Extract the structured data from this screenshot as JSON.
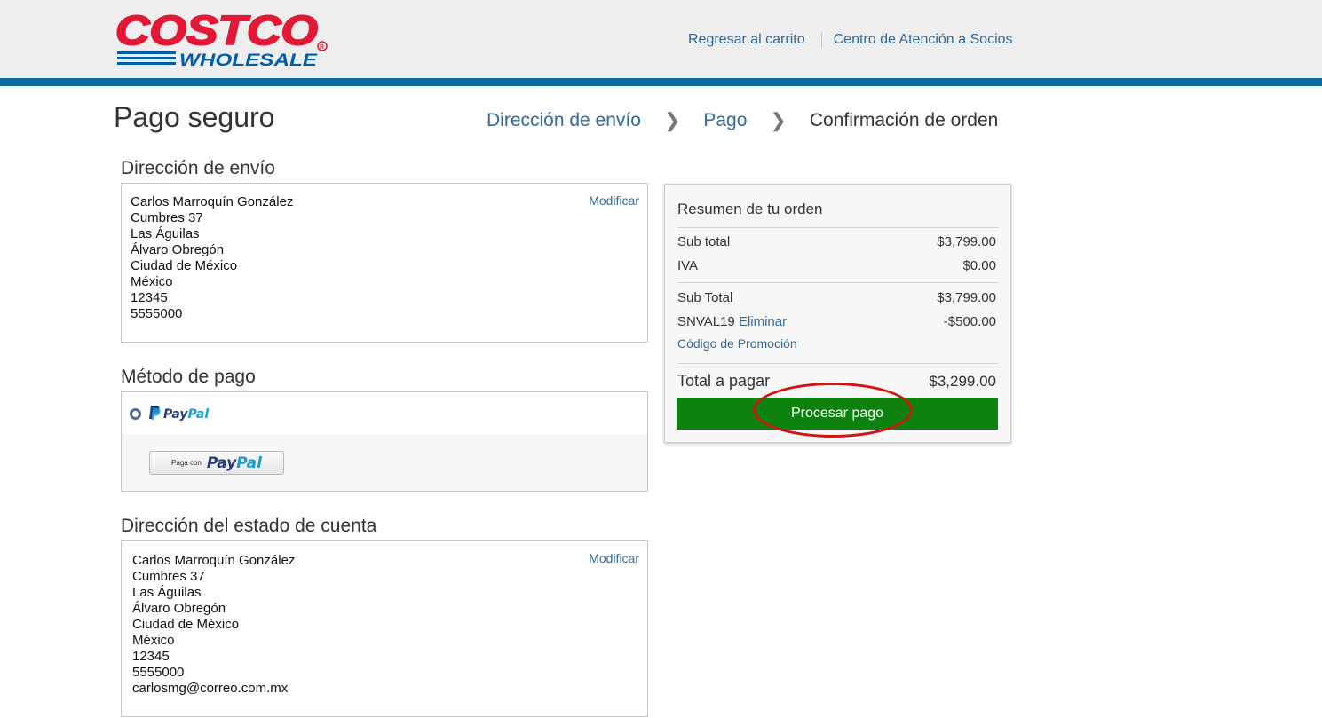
{
  "header": {
    "logo_top": "COSTCO",
    "logo_bottom": "WHOLESALE",
    "links": [
      "Regresar al carrito",
      "Centro de Atención a Socios"
    ]
  },
  "page": {
    "title": "Pago seguro",
    "steps": [
      "Dirección de envío",
      "Pago",
      "Confirmación de orden"
    ]
  },
  "shipping": {
    "title": "Dirección de envío",
    "modify": "Modificar",
    "lines": [
      "Carlos Marroquín González",
      "Cumbres 37",
      "Las Águilas",
      "Álvaro Obregón",
      "Ciudad de México",
      "México",
      "12345",
      "5555000"
    ]
  },
  "payment": {
    "title": "Método de pago",
    "option_brand_dark": "Pay",
    "option_brand_light": "Pal",
    "button_prefix": "Paga con",
    "button_brand_dark": "Pay",
    "button_brand_light": "Pal"
  },
  "billing": {
    "title": "Dirección del estado de cuenta",
    "modify": "Modificar",
    "lines": [
      "Carlos Marroquín González",
      "Cumbres 37",
      "Las Águilas",
      "Álvaro Obregón",
      "Ciudad de México",
      "México",
      "12345",
      "5555000",
      "carlosmg@correo.com.mx"
    ]
  },
  "summary": {
    "title": "Resumen de tu orden",
    "subtotal_label": "Sub total",
    "subtotal_value": "$3,799.00",
    "iva_label": "IVA",
    "iva_value": "$0.00",
    "subtotal2_label": "Sub Total",
    "subtotal2_value": "$3,799.00",
    "promo_code": "SNVAL19",
    "promo_remove": "Eliminar",
    "promo_value": "-$500.00",
    "promo_link": "Código de Promoción",
    "total_label": "Total a pagar",
    "total_value": "$3,299.00",
    "process_button": "Procesar pago"
  },
  "colors": {
    "link": "#2f6aa0",
    "header_bar": "#0a6aa1",
    "logo_red": "#e31837",
    "logo_blue": "#005daa",
    "process_button": "#0e820e",
    "annotation": "#d21414"
  }
}
